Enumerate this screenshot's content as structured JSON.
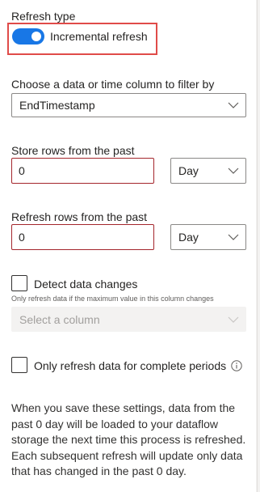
{
  "refresh_type": {
    "heading": "Refresh type",
    "toggle_label": "Incremental refresh",
    "toggle_on": true
  },
  "filter_column": {
    "label": "Choose a data or time column to filter by",
    "selected": "EndTimestamp"
  },
  "store_rows": {
    "label": "Store rows from the past",
    "value": "0",
    "unit": "Day"
  },
  "refresh_rows": {
    "label": "Refresh rows from the past",
    "value": "0",
    "unit": "Day"
  },
  "detect_changes": {
    "label": "Detect data changes",
    "checked": false,
    "hint": "Only refresh data if the maximum value in this column changes",
    "column_placeholder": "Select a column"
  },
  "complete_periods": {
    "label": "Only refresh data for complete periods",
    "checked": false
  },
  "summary": "When you save these settings, data from the past 0 day will be loaded to your dataflow storage the next time this process is refreshed. Each subsequent refresh will update only data that has changed in the past 0 day.",
  "colors": {
    "accent": "#1877e6",
    "highlight": "#e04b49",
    "error_border": "#a4262c"
  }
}
